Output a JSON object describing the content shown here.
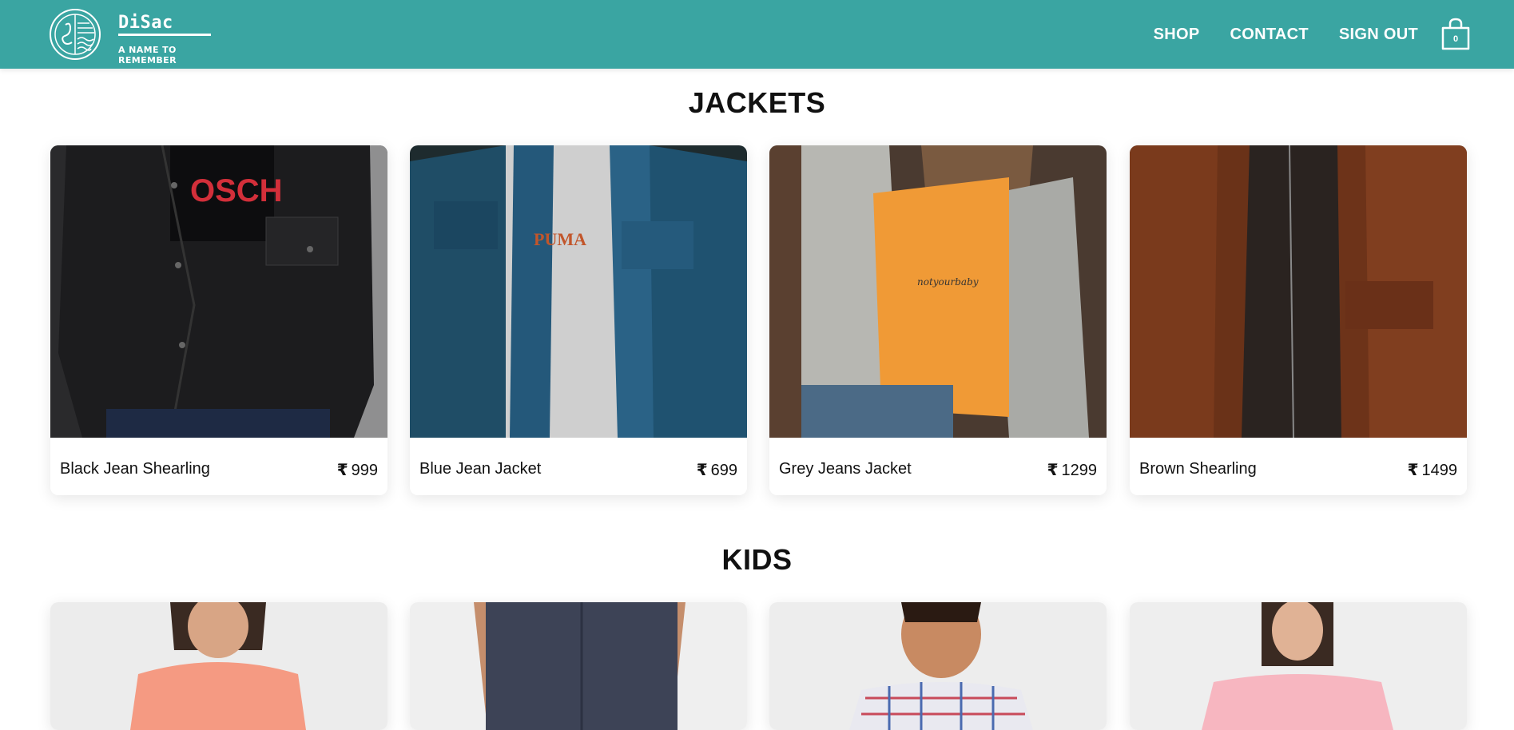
{
  "brand": {
    "name": "DiSac",
    "tagline": "A NAME TO REMEMBER"
  },
  "nav": {
    "shop": "SHOP",
    "contact": "CONTACT",
    "sign_out": "SIGN OUT",
    "cart_count": "0"
  },
  "colors": {
    "header_bg": "#3aa5a2",
    "text": "#111111"
  },
  "sections": [
    {
      "title": "JACKETS",
      "items": [
        {
          "name": "Black Jean Shearling",
          "currency": "₹",
          "price": "999"
        },
        {
          "name": "Blue Jean Jacket",
          "currency": "₹",
          "price": "699"
        },
        {
          "name": "Grey Jeans Jacket",
          "currency": "₹",
          "price": "1299"
        },
        {
          "name": "Brown Shearling",
          "currency": "₹",
          "price": "1499"
        }
      ]
    },
    {
      "title": "KIDS",
      "items": []
    }
  ]
}
